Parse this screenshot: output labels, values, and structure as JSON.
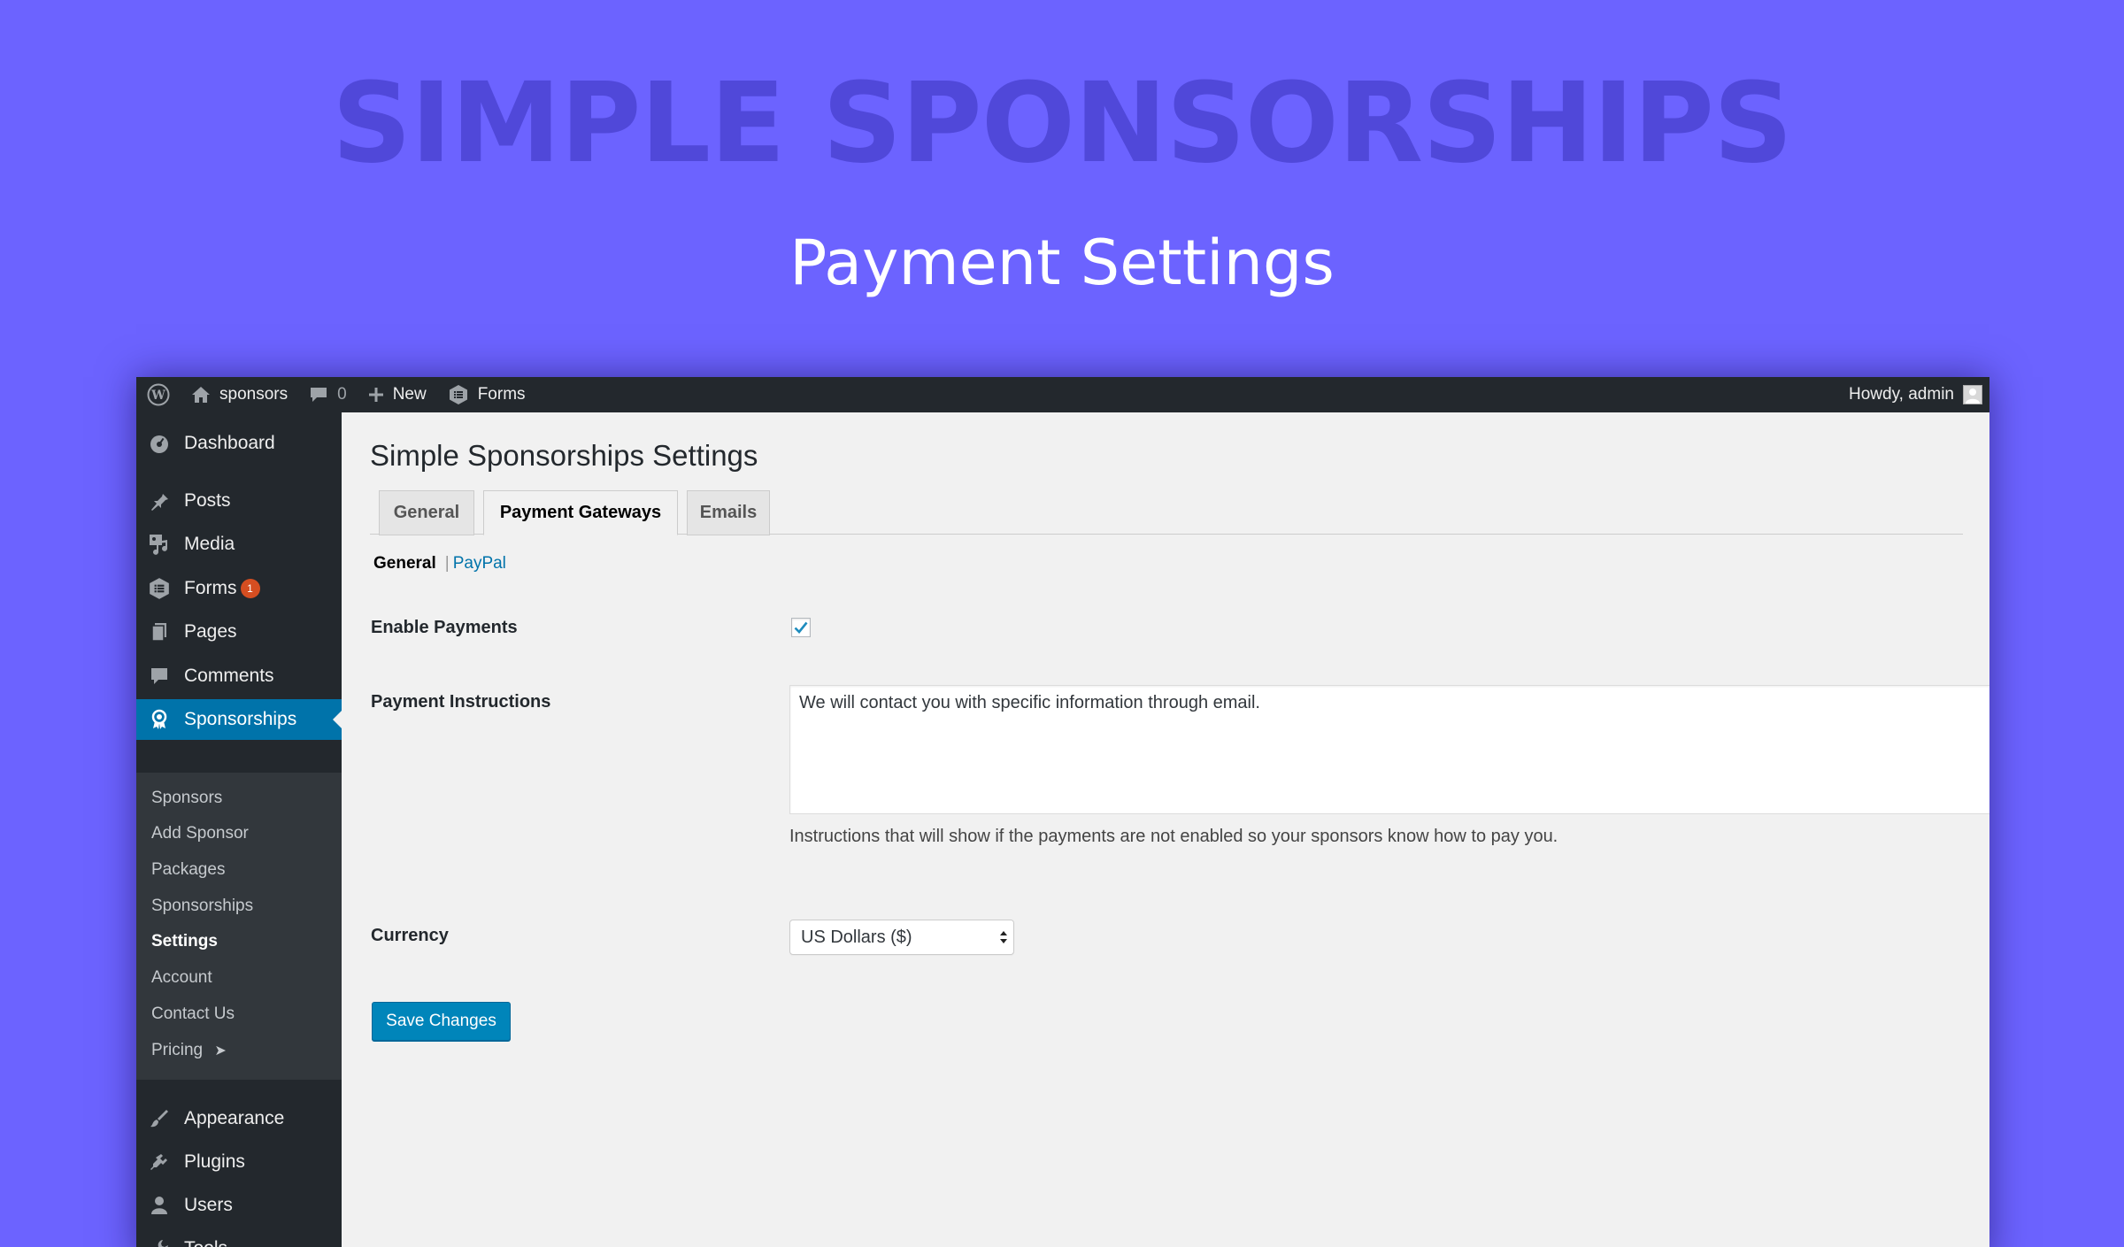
{
  "hero": {
    "title": "SIMPLE SPONSORSHIPS",
    "subtitle": "Payment Settings"
  },
  "adminbar": {
    "site_name": "sponsors",
    "comments_count": "0",
    "new_label": "New",
    "forms_label": "Forms",
    "greeting": "Howdy, admin"
  },
  "sidebar": {
    "items": [
      {
        "label": "Dashboard",
        "icon": "dashboard-icon"
      },
      {
        "label": "Posts",
        "icon": "pushpin-icon"
      },
      {
        "label": "Media",
        "icon": "media-icon"
      },
      {
        "label": "Forms",
        "icon": "forms-icon",
        "badge": "1"
      },
      {
        "label": "Pages",
        "icon": "pages-icon"
      },
      {
        "label": "Comments",
        "icon": "comment-icon"
      },
      {
        "label": "Sponsorships",
        "icon": "award-icon"
      },
      {
        "label": "Appearance",
        "icon": "paintbrush-icon"
      },
      {
        "label": "Plugins",
        "icon": "plugin-icon"
      },
      {
        "label": "Users",
        "icon": "user-icon"
      },
      {
        "label": "Tools",
        "icon": "wrench-icon"
      }
    ],
    "submenu": [
      "Sponsors",
      "Add Sponsor",
      "Packages",
      "Sponsorships",
      "Settings",
      "Account",
      "Contact Us",
      "Pricing"
    ],
    "submenu_pricing_arrow": "➤"
  },
  "page": {
    "title": "Simple Sponsorships Settings",
    "tabs": [
      "General",
      "Payment Gateways",
      "Emails"
    ],
    "subsections": {
      "current": "General",
      "separator": "|",
      "other": "PayPal"
    },
    "fields": {
      "enable_payments": {
        "label": "Enable Payments",
        "checked": true
      },
      "payment_instructions": {
        "label": "Payment Instructions",
        "value": "We will contact you with specific information through email.",
        "description": "Instructions that will show if the payments are not enabled so your sponsors know how to pay you."
      },
      "currency": {
        "label": "Currency",
        "value": "US Dollars ($)"
      }
    },
    "save_label": "Save Changes"
  },
  "colors": {
    "background": "#6c63ff",
    "hero_title": "#5048d9",
    "admin_dark": "#23282d",
    "active_blue": "#0073aa",
    "button_blue": "#0085ba",
    "badge_orange": "#d54e21"
  }
}
